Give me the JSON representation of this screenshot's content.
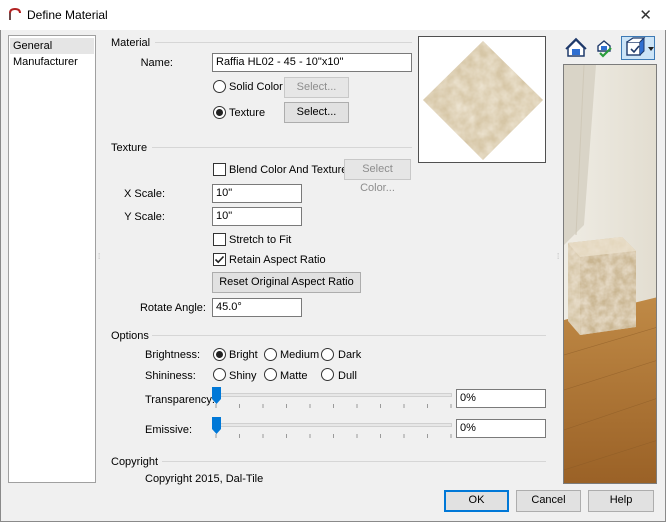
{
  "window": {
    "title": "Define Material",
    "close_glyph": "✕",
    "icon": "chief-architect-logo-icon"
  },
  "nav": {
    "items": [
      {
        "label": "General",
        "selected": true
      },
      {
        "label": "Manufacturer",
        "selected": false
      }
    ]
  },
  "material": {
    "section_label": "Material",
    "name_label": "Name:",
    "name_value": "Raffia HL02 - 45 - 10\"x10\"",
    "solid_color_label": "Solid Color",
    "solid_color_selected": false,
    "solid_select_label": "Select...",
    "texture_label": "Texture",
    "texture_selected": true,
    "texture_select_label": "Select..."
  },
  "texture": {
    "section_label": "Texture",
    "blend_label": "Blend Color And Texture",
    "blend_checked": false,
    "select_color_label": "Select Color...",
    "x_scale_label": "X Scale:",
    "x_scale_value": "10\"",
    "y_scale_label": "Y Scale:",
    "y_scale_value": "10\"",
    "stretch_label": "Stretch to Fit",
    "stretch_checked": false,
    "retain_label": "Retain Aspect Ratio",
    "retain_checked": true,
    "reset_label": "Reset Original Aspect Ratio",
    "rotate_label": "Rotate Angle:",
    "rotate_value": "45.0°"
  },
  "options": {
    "section_label": "Options",
    "brightness_label": "Brightness:",
    "brightness_options": [
      "Bright",
      "Medium",
      "Dark"
    ],
    "brightness_selected": "Bright",
    "shininess_label": "Shininess:",
    "shininess_options": [
      "Shiny",
      "Matte",
      "Dull"
    ],
    "shininess_selected": null,
    "transparency_label": "Transparency:",
    "transparency_value": "0%",
    "transparency_level": 0,
    "emissive_label": "Emissive:",
    "emissive_value": "0%",
    "emissive_level": 0
  },
  "copyright": {
    "section_label": "Copyright",
    "text": "Copyright 2015, Dal-Tile"
  },
  "toolbar": {
    "icons": [
      "material-preview-icon",
      "check-material-icon",
      "view-options-icon"
    ]
  },
  "footer": {
    "ok_label": "OK",
    "cancel_label": "Cancel",
    "help_label": "Help"
  },
  "colors": {
    "accent": "#0078d7",
    "tile": "#d8c8a8",
    "floor": "#b07a3c",
    "wall": "#e9e6dc"
  }
}
